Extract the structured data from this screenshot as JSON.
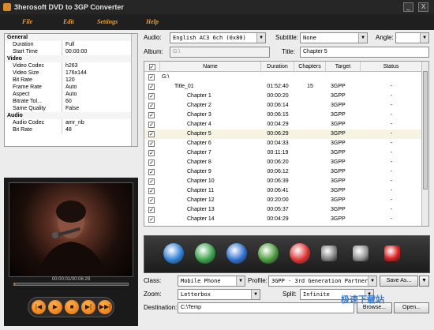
{
  "window": {
    "title": "3herosoft DVD to 3GP Converter",
    "min": "_",
    "close": "X"
  },
  "menu": [
    "File",
    "Edit",
    "Settings",
    "Help"
  ],
  "props": [
    {
      "cat": true,
      "k": "General",
      "v": ""
    },
    {
      "k": "Duration",
      "v": "Full"
    },
    {
      "k": "Start Time",
      "v": "00:00:00"
    },
    {
      "cat": true,
      "k": "Video",
      "v": ""
    },
    {
      "k": "Video Codec",
      "v": "h263"
    },
    {
      "k": "Video Size",
      "v": "176x144"
    },
    {
      "k": "Bit Rate",
      "v": "120"
    },
    {
      "k": "Frame Rate",
      "v": "Auto"
    },
    {
      "k": "Aspect",
      "v": "Auto"
    },
    {
      "k": "Bitrate Tol...",
      "v": "60"
    },
    {
      "k": "Same Quality",
      "v": "False"
    },
    {
      "cat": true,
      "k": "Audio",
      "v": ""
    },
    {
      "k": "Audio Codec",
      "v": "amr_nb"
    },
    {
      "k": "Bit Rate",
      "v": "48"
    }
  ],
  "player": {
    "time": "00:00:01/00:06:29",
    "progress": 0.003,
    "buttons": [
      "|◀",
      "▶",
      "■",
      "▶|",
      "▶▶|"
    ]
  },
  "top": {
    "audio_label": "Audio:",
    "audio_value": "English AC3 6ch (0x80)",
    "subtitle_label": "Subtitle:",
    "subtitle_value": "None",
    "angle_label": "Angle:",
    "angle_value": "",
    "album_label": "Album:",
    "album_value": "G:\\",
    "title_label": "Title:",
    "title_value": "Chapter 5"
  },
  "grid": {
    "headers": [
      "",
      "Name",
      "Duration",
      "Chapters",
      "Target",
      "Status"
    ],
    "rows": [
      {
        "name": "G:\\",
        "indent": 0,
        "duration": "",
        "chapters": "",
        "target": "",
        "status": ""
      },
      {
        "name": "Title_01",
        "indent": 1,
        "duration": "01:52:40",
        "chapters": "15",
        "target": "3GPP",
        "status": "-"
      },
      {
        "name": "Chapter 1",
        "indent": 2,
        "duration": "00:00:20",
        "chapters": "",
        "target": "3GPP",
        "status": "-"
      },
      {
        "name": "Chapter 2",
        "indent": 2,
        "duration": "00:06:14",
        "chapters": "",
        "target": "3GPP",
        "status": "-"
      },
      {
        "name": "Chapter 3",
        "indent": 2,
        "duration": "00:06:15",
        "chapters": "",
        "target": "3GPP",
        "status": "-"
      },
      {
        "name": "Chapter 4",
        "indent": 2,
        "duration": "00:04:29",
        "chapters": "",
        "target": "3GPP",
        "status": "-"
      },
      {
        "name": "Chapter 5",
        "indent": 2,
        "duration": "00:06:29",
        "chapters": "",
        "target": "3GPP",
        "status": "-",
        "selected": true
      },
      {
        "name": "Chapter 6",
        "indent": 2,
        "duration": "00:04:33",
        "chapters": "",
        "target": "3GPP",
        "status": "-"
      },
      {
        "name": "Chapter 7",
        "indent": 2,
        "duration": "00:11:19",
        "chapters": "",
        "target": "3GPP",
        "status": "-"
      },
      {
        "name": "Chapter 8",
        "indent": 2,
        "duration": "00:06:20",
        "chapters": "",
        "target": "3GPP",
        "status": "-"
      },
      {
        "name": "Chapter 9",
        "indent": 2,
        "duration": "00:06:12",
        "chapters": "",
        "target": "3GPP",
        "status": "-"
      },
      {
        "name": "Chapter 10",
        "indent": 2,
        "duration": "00:06:39",
        "chapters": "",
        "target": "3GPP",
        "status": "-"
      },
      {
        "name": "Chapter 11",
        "indent": 2,
        "duration": "00:06:41",
        "chapters": "",
        "target": "3GPP",
        "status": "-"
      },
      {
        "name": "Chapter 12",
        "indent": 2,
        "duration": "00:20:00",
        "chapters": "",
        "target": "3GPP",
        "status": "-"
      },
      {
        "name": "Chapter 13",
        "indent": 2,
        "duration": "00:05:37",
        "chapters": "",
        "target": "3GPP",
        "status": "-"
      },
      {
        "name": "Chapter 14",
        "indent": 2,
        "duration": "00:04:29",
        "chapters": "",
        "target": "3GPP",
        "status": "-"
      }
    ]
  },
  "toolbar": [
    {
      "name": "open-dvd-icon",
      "color": "#2f7fd6"
    },
    {
      "name": "add-icon",
      "color": "#3aa14a"
    },
    {
      "name": "settings-icon",
      "color": "#2f6fd0"
    },
    {
      "name": "clip-icon",
      "color": "#4a9a3a"
    },
    {
      "name": "snapshot-icon",
      "color": "#d33"
    },
    {
      "name": "pause-icon",
      "color": "#888"
    },
    {
      "name": "stop-icon",
      "color": "#999"
    },
    {
      "name": "record-icon",
      "color": "#d22"
    }
  ],
  "bottom": {
    "class_label": "Class:",
    "class_value": "Mobile Phone",
    "profile_label": "Profile:",
    "profile_value": "3GPP - 3rd Generation Partnership",
    "save_as": "Save As...",
    "zoom_label": "Zoom:",
    "zoom_value": "Letterbox",
    "split_label": "Split:",
    "split_value": "Infinite",
    "dest_label": "Destination:",
    "dest_value": "C:\\Temp",
    "browse": "Browse...",
    "open": "Open..."
  },
  "watermark": "极速下载站"
}
